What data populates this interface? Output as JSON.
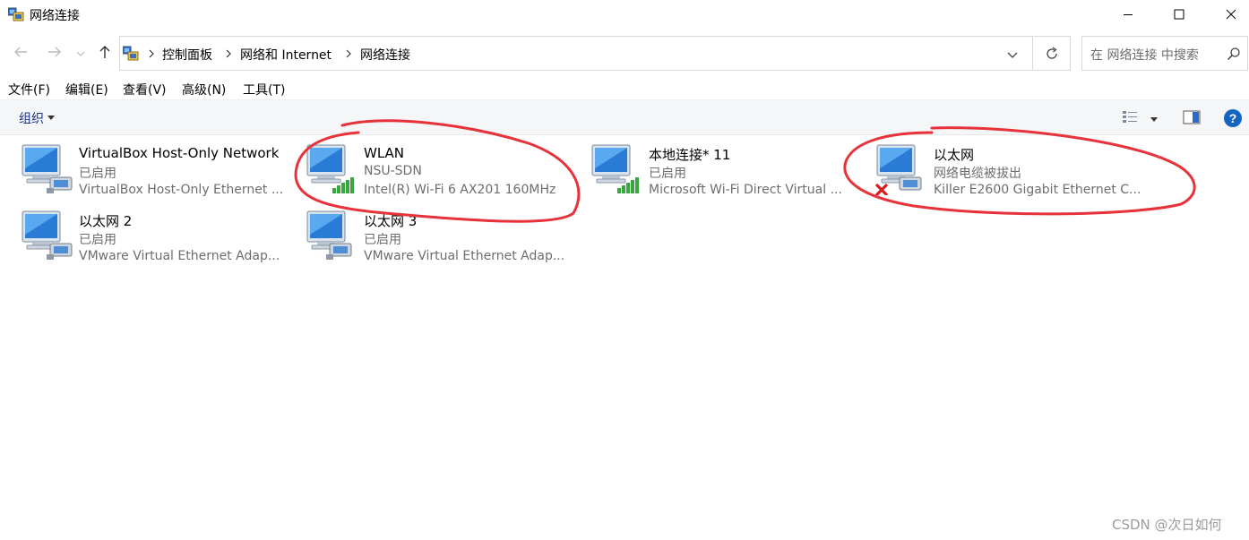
{
  "window": {
    "title": "网络连接",
    "controls": [
      "minimize",
      "maximize",
      "close"
    ]
  },
  "address": {
    "breadcrumbs": [
      "控制面板",
      "网络和 Internet",
      "网络连接"
    ],
    "search_placeholder": "在 网络连接 中搜索"
  },
  "menu": {
    "items": [
      "文件(F)",
      "编辑(E)",
      "查看(V)",
      "高级(N)",
      "工具(T)"
    ]
  },
  "commandbar": {
    "organize_label": "组织"
  },
  "connections": [
    {
      "name": "VirtualBox Host-Only Network",
      "status": "已启用",
      "device": "VirtualBox Host-Only Ethernet ...",
      "type": "ethernet",
      "connected": true
    },
    {
      "name": "WLAN",
      "status": "NSU-SDN",
      "device": "Intel(R) Wi-Fi 6 AX201 160MHz",
      "type": "wifi",
      "connected": true
    },
    {
      "name": "本地连接* 11",
      "status": "已启用",
      "device": "Microsoft Wi-Fi Direct Virtual ...",
      "type": "wifi",
      "connected": true
    },
    {
      "name": "以太网",
      "status": "网络电缆被拔出",
      "device": "Killer E2600 Gigabit Ethernet C...",
      "type": "ethernet",
      "connected": false
    },
    {
      "name": "以太网 2",
      "status": "已启用",
      "device": "VMware Virtual Ethernet Adap...",
      "type": "ethernet",
      "connected": true
    },
    {
      "name": "以太网 3",
      "status": "已启用",
      "device": "VMware Virtual Ethernet Adap...",
      "type": "ethernet",
      "connected": true
    }
  ],
  "watermark": "CSDN @次日如何",
  "colors": {
    "annotation": "#e8323a",
    "wifi_bars": "#3aa541",
    "link_blue": "#1e3287",
    "help_blue": "#1565c0"
  }
}
